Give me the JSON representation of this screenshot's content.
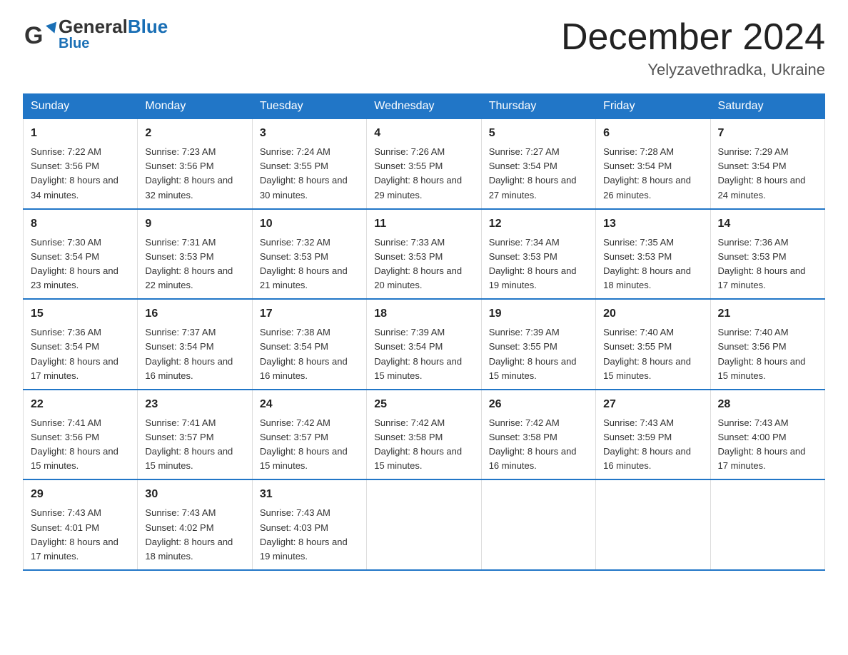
{
  "logo": {
    "general": "General",
    "blue": "Blue",
    "alt": "GeneralBlue logo"
  },
  "header": {
    "month": "December 2024",
    "location": "Yelyzavethradka, Ukraine"
  },
  "columns": [
    "Sunday",
    "Monday",
    "Tuesday",
    "Wednesday",
    "Thursday",
    "Friday",
    "Saturday"
  ],
  "weeks": [
    [
      {
        "day": "1",
        "sunrise": "7:22 AM",
        "sunset": "3:56 PM",
        "daylight": "8 hours and 34 minutes."
      },
      {
        "day": "2",
        "sunrise": "7:23 AM",
        "sunset": "3:56 PM",
        "daylight": "8 hours and 32 minutes."
      },
      {
        "day": "3",
        "sunrise": "7:24 AM",
        "sunset": "3:55 PM",
        "daylight": "8 hours and 30 minutes."
      },
      {
        "day": "4",
        "sunrise": "7:26 AM",
        "sunset": "3:55 PM",
        "daylight": "8 hours and 29 minutes."
      },
      {
        "day": "5",
        "sunrise": "7:27 AM",
        "sunset": "3:54 PM",
        "daylight": "8 hours and 27 minutes."
      },
      {
        "day": "6",
        "sunrise": "7:28 AM",
        "sunset": "3:54 PM",
        "daylight": "8 hours and 26 minutes."
      },
      {
        "day": "7",
        "sunrise": "7:29 AM",
        "sunset": "3:54 PM",
        "daylight": "8 hours and 24 minutes."
      }
    ],
    [
      {
        "day": "8",
        "sunrise": "7:30 AM",
        "sunset": "3:54 PM",
        "daylight": "8 hours and 23 minutes."
      },
      {
        "day": "9",
        "sunrise": "7:31 AM",
        "sunset": "3:53 PM",
        "daylight": "8 hours and 22 minutes."
      },
      {
        "day": "10",
        "sunrise": "7:32 AM",
        "sunset": "3:53 PM",
        "daylight": "8 hours and 21 minutes."
      },
      {
        "day": "11",
        "sunrise": "7:33 AM",
        "sunset": "3:53 PM",
        "daylight": "8 hours and 20 minutes."
      },
      {
        "day": "12",
        "sunrise": "7:34 AM",
        "sunset": "3:53 PM",
        "daylight": "8 hours and 19 minutes."
      },
      {
        "day": "13",
        "sunrise": "7:35 AM",
        "sunset": "3:53 PM",
        "daylight": "8 hours and 18 minutes."
      },
      {
        "day": "14",
        "sunrise": "7:36 AM",
        "sunset": "3:53 PM",
        "daylight": "8 hours and 17 minutes."
      }
    ],
    [
      {
        "day": "15",
        "sunrise": "7:36 AM",
        "sunset": "3:54 PM",
        "daylight": "8 hours and 17 minutes."
      },
      {
        "day": "16",
        "sunrise": "7:37 AM",
        "sunset": "3:54 PM",
        "daylight": "8 hours and 16 minutes."
      },
      {
        "day": "17",
        "sunrise": "7:38 AM",
        "sunset": "3:54 PM",
        "daylight": "8 hours and 16 minutes."
      },
      {
        "day": "18",
        "sunrise": "7:39 AM",
        "sunset": "3:54 PM",
        "daylight": "8 hours and 15 minutes."
      },
      {
        "day": "19",
        "sunrise": "7:39 AM",
        "sunset": "3:55 PM",
        "daylight": "8 hours and 15 minutes."
      },
      {
        "day": "20",
        "sunrise": "7:40 AM",
        "sunset": "3:55 PM",
        "daylight": "8 hours and 15 minutes."
      },
      {
        "day": "21",
        "sunrise": "7:40 AM",
        "sunset": "3:56 PM",
        "daylight": "8 hours and 15 minutes."
      }
    ],
    [
      {
        "day": "22",
        "sunrise": "7:41 AM",
        "sunset": "3:56 PM",
        "daylight": "8 hours and 15 minutes."
      },
      {
        "day": "23",
        "sunrise": "7:41 AM",
        "sunset": "3:57 PM",
        "daylight": "8 hours and 15 minutes."
      },
      {
        "day": "24",
        "sunrise": "7:42 AM",
        "sunset": "3:57 PM",
        "daylight": "8 hours and 15 minutes."
      },
      {
        "day": "25",
        "sunrise": "7:42 AM",
        "sunset": "3:58 PM",
        "daylight": "8 hours and 15 minutes."
      },
      {
        "day": "26",
        "sunrise": "7:42 AM",
        "sunset": "3:58 PM",
        "daylight": "8 hours and 16 minutes."
      },
      {
        "day": "27",
        "sunrise": "7:43 AM",
        "sunset": "3:59 PM",
        "daylight": "8 hours and 16 minutes."
      },
      {
        "day": "28",
        "sunrise": "7:43 AM",
        "sunset": "4:00 PM",
        "daylight": "8 hours and 17 minutes."
      }
    ],
    [
      {
        "day": "29",
        "sunrise": "7:43 AM",
        "sunset": "4:01 PM",
        "daylight": "8 hours and 17 minutes."
      },
      {
        "day": "30",
        "sunrise": "7:43 AM",
        "sunset": "4:02 PM",
        "daylight": "8 hours and 18 minutes."
      },
      {
        "day": "31",
        "sunrise": "7:43 AM",
        "sunset": "4:03 PM",
        "daylight": "8 hours and 19 minutes."
      },
      {
        "day": "",
        "sunrise": "",
        "sunset": "",
        "daylight": ""
      },
      {
        "day": "",
        "sunrise": "",
        "sunset": "",
        "daylight": ""
      },
      {
        "day": "",
        "sunrise": "",
        "sunset": "",
        "daylight": ""
      },
      {
        "day": "",
        "sunrise": "",
        "sunset": "",
        "daylight": ""
      }
    ]
  ],
  "labels": {
    "sunrise": "Sunrise: ",
    "sunset": "Sunset: ",
    "daylight": "Daylight: "
  }
}
